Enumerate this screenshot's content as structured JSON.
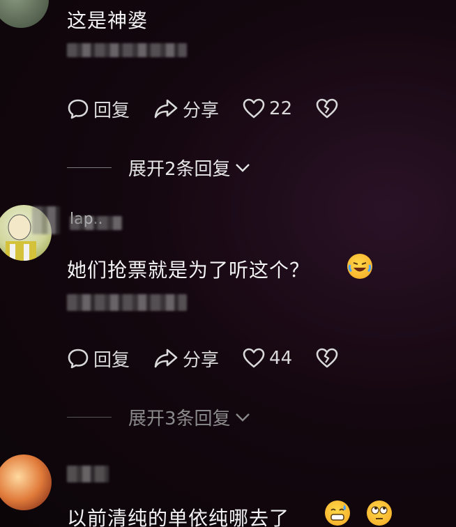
{
  "comments": [
    {
      "text": "这是神婆",
      "reply_label": "回复",
      "share_label": "分享",
      "like_count": "22",
      "expand_label": "展开2条回复"
    },
    {
      "username": "lap..",
      "text": "她们抢票就是为了听这个？",
      "reply_label": "回复",
      "share_label": "分享",
      "like_count": "44",
      "expand_label": "展开3条回复"
    },
    {
      "text": "以前清纯的单依纯哪去了"
    }
  ],
  "colors": {
    "background": "#0b0508",
    "text": "#f2f2f2",
    "action": "#d9d9d9",
    "dim": "#8a8a8a"
  }
}
